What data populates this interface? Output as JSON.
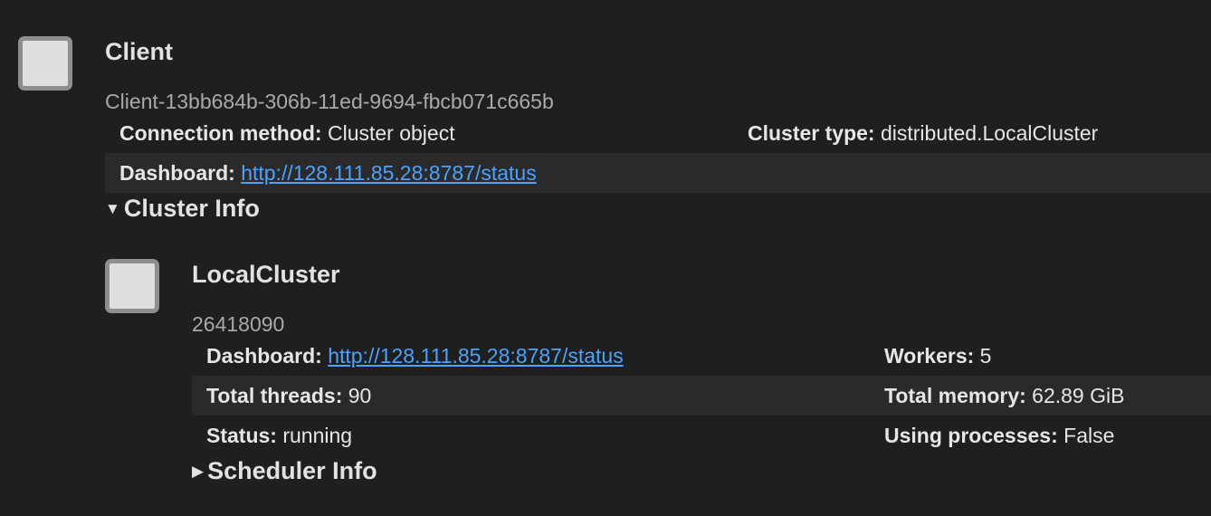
{
  "client": {
    "icon": "client-square-icon",
    "title": "Client",
    "id": "Client-13bb684b-306b-11ed-9694-fbcb071c665b",
    "connection_method_label": "Connection method:",
    "connection_method_value": "Cluster object",
    "cluster_type_label": "Cluster type:",
    "cluster_type_value": "distributed.LocalCluster",
    "dashboard_label": "Dashboard:",
    "dashboard_url": "http://128.111.85.28:8787/status"
  },
  "cluster_info": {
    "expanded": true,
    "summary": "Cluster Info",
    "icon": "cluster-square-icon",
    "title": "LocalCluster",
    "id": "26418090",
    "dashboard_label": "Dashboard:",
    "dashboard_url": "http://128.111.85.28:8787/status",
    "workers_label": "Workers:",
    "workers_value": "5",
    "threads_label": "Total threads:",
    "threads_value": "90",
    "memory_label": "Total memory:",
    "memory_value": "62.89 GiB",
    "status_label": "Status:",
    "status_value": "running",
    "processes_label": "Using processes:",
    "processes_value": "False"
  },
  "scheduler_info": {
    "expanded": false,
    "summary": "Scheduler Info"
  },
  "colors": {
    "background": "#1f1f1f",
    "shaded_row": "#2a2a2a",
    "link": "#4aa3ff",
    "icon_fill": "#dedede",
    "icon_border": "#8e8e8e"
  }
}
